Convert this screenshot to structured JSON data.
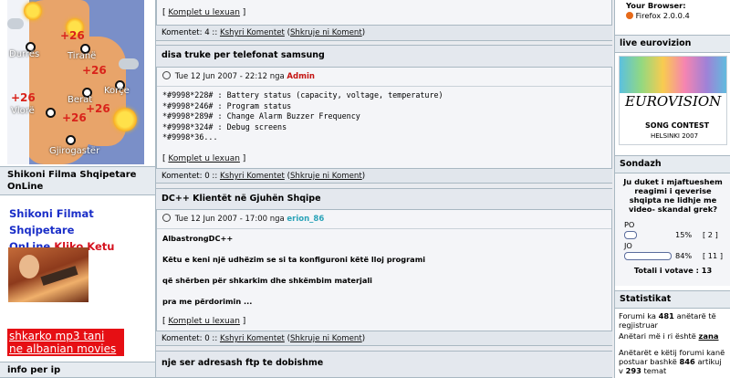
{
  "left": {
    "weather_map": {
      "cities": [
        "Durrës",
        "Tiranë",
        "Berat",
        "Korçe",
        "Vlorë",
        "Gjirogastër"
      ],
      "temps": [
        "+26",
        "+26",
        "+26",
        "+26",
        "+26"
      ]
    },
    "films_title": "Shikoni Filma Shqipetare OnLine",
    "films_promo_line1": "Shikoni Filmat Shqipetare",
    "films_promo_line2_blue": "OnLine",
    "films_promo_link": "Kliko Ketu",
    "mp3_line1": "shkarko mp3 tani",
    "mp3_line2": "ne albanian movies",
    "info_title": "info per ip"
  },
  "posts": [
    {
      "readmore": "Komplet u lexuan",
      "comments_count": "Komentet: 4 ::",
      "read_comments": "Kshyri Komentet",
      "write_comment": "Shkruje ni Koment"
    },
    {
      "title": "disa truke per telefonat samsung",
      "date": "Tue 12 Jun 2007 - 22:12 nga",
      "author": "Admin",
      "lines": [
        "*#9998*228# : Battery status (capacity, voltage, temperature)",
        "*#9998*246# : Program status",
        "*#9998*289# : Change Alarm Buzzer Frequency",
        "*#9998*324# : Debug screens",
        "*#9998*36..."
      ],
      "readmore": "Komplet u lexuan",
      "comments_count": "Komentet: 0 ::",
      "read_comments": "Kshyri Komentet",
      "write_comment": "Shkruje ni Koment"
    },
    {
      "title": "DC++ Klientët në Gjuhën Shqipe",
      "date": "Tue 12 Jun 2007 - 17:00 nga",
      "author": "erion_86",
      "lines": [
        "AlbastrongDC++",
        "Këtu e keni një udhëzim se si ta konfiguroni këtë lloj programi",
        "që shërben për shkarkim dhe shkëmbim materjali",
        "pra me përdorimin ..."
      ],
      "readmore": "Komplet u lexuan",
      "comments_count": "Komentet: 0 ::",
      "read_comments": "Kshyri Komentet",
      "write_comment": "Shkruje ni Koment"
    },
    {
      "title": "nje ser adresash ftp te dobishme"
    }
  ],
  "right": {
    "browser_label": "Your Browser:",
    "browser_value": "Firefox 2.0.0.4",
    "eurovision_title": "live eurovizion",
    "euro_logo_text": "EUROVISION",
    "euro_song_contest": "SONG CONTEST",
    "euro_city": "HELSINKI 2007",
    "poll_title": "Sondazh",
    "poll_question": "Ju duket i mjaftueshem reagimi i qeverise shqipta ne lidhje me video- skandal grek?",
    "poll_options": [
      {
        "label": "PO",
        "percent": "15%",
        "count": "[ 2 ]",
        "fraction": 0.15
      },
      {
        "label": "JO",
        "percent": "84%",
        "count": "[ 11 ]",
        "fraction": 0.84
      }
    ],
    "poll_total": "Totali i votave : 13",
    "stats_title": "Statistikat",
    "stats_line1_pre": "Forumi ka",
    "stats_members": "481",
    "stats_line1_post": "anëtarë të regjistruar",
    "stats_line2_pre": "Anëtari më i ri është",
    "stats_newest": "zana",
    "stats_line3_pre": "Anëtarët e këtij forumi kanë postuar bashkë",
    "stats_articles": "846",
    "stats_line3_mid": "artikuj v",
    "stats_topics": "293",
    "stats_line3_post": "temat"
  }
}
